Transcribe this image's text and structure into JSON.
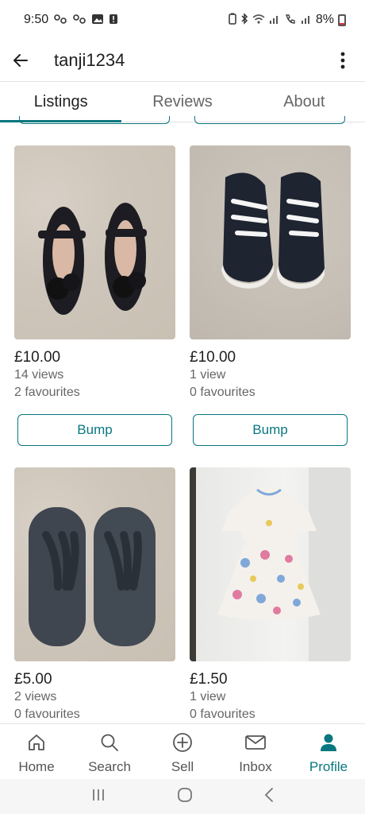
{
  "status_bar": {
    "time": "9:50",
    "battery": "8%"
  },
  "app_bar": {
    "title": "tanji1234",
    "icons": {
      "back": "arrow-left-icon",
      "more": "more-vertical-icon"
    }
  },
  "tabs": [
    {
      "label": "Listings",
      "active": true
    },
    {
      "label": "Reviews",
      "active": false
    },
    {
      "label": "About",
      "active": false
    }
  ],
  "listings": [
    {
      "price": "£10.00",
      "views": "14 views",
      "favourites": "2 favourites",
      "bump_label": "Bump"
    },
    {
      "price": "£10.00",
      "views": "1 view",
      "favourites": "0 favourites",
      "bump_label": "Bump"
    },
    {
      "price": "£5.00",
      "views": "2 views",
      "favourites": "0 favourites"
    },
    {
      "price": "£1.50",
      "views": "1 view",
      "favourites": "0 favourites"
    }
  ],
  "bottom_nav": [
    {
      "label": "Home",
      "icon": "home-icon",
      "active": false
    },
    {
      "label": "Search",
      "icon": "search-icon",
      "active": false
    },
    {
      "label": "Sell",
      "icon": "plus-circle-icon",
      "active": false
    },
    {
      "label": "Inbox",
      "icon": "mail-icon",
      "active": false
    },
    {
      "label": "Profile",
      "icon": "person-icon",
      "active": true
    }
  ],
  "colors": {
    "accent": "#09777f",
    "text_primary": "#1f1f1f",
    "text_secondary": "#666666"
  }
}
